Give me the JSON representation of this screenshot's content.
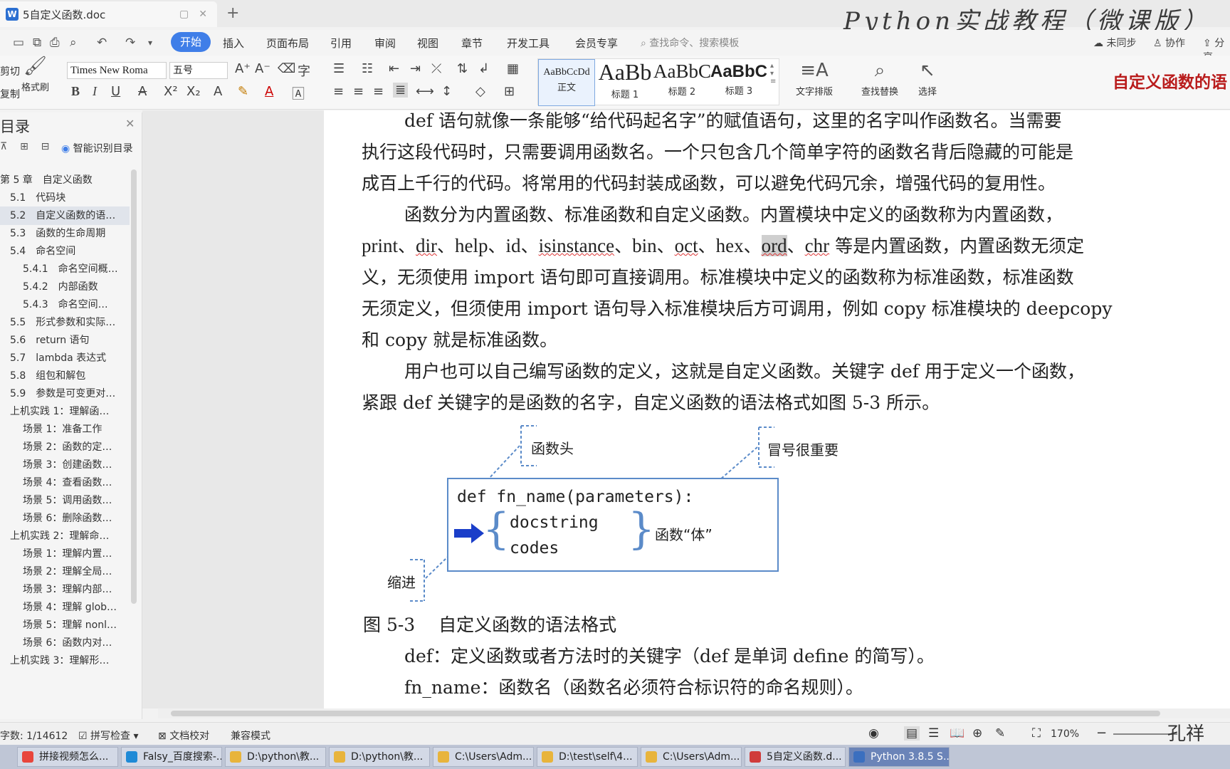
{
  "window": {
    "tab_title": "5自定义函数.doc",
    "new_tab": "+",
    "watermark": "Python实战教程（微课版）"
  },
  "menu": {
    "items": [
      "开始",
      "插入",
      "页面布局",
      "引用",
      "审阅",
      "视图",
      "章节",
      "开发工具",
      "会员专享"
    ],
    "search_placeholder": "查找命令、搜索模板",
    "sync": "未同步",
    "collab": "协作",
    "share": "分享"
  },
  "ribbon": {
    "cut": "剪切",
    "copy": "复制",
    "format_painter": "格式刷",
    "font_name": "Times New Roma",
    "font_size": "五号",
    "styles": [
      {
        "preview": "AaBbCcDd",
        "name": "正文"
      },
      {
        "preview": "AaBb",
        "name": "标题 1"
      },
      {
        "preview": "AaBbC",
        "name": "标题 2"
      },
      {
        "preview": "AaBbC",
        "name": "标题 3"
      }
    ],
    "text_layout": "文字排版",
    "find_replace": "查找替换",
    "select": "选择",
    "red_heading": "自定义函数的语"
  },
  "sidebar": {
    "title": "目录",
    "smart_toc": "智能识别目录",
    "items": [
      {
        "label": "第 5 章　自定义函数"
      },
      {
        "label": "5.1　代码块"
      },
      {
        "label": "5.2　自定义函数的语…"
      },
      {
        "label": "5.3　函数的生命周期"
      },
      {
        "label": "5.4　命名空间"
      },
      {
        "label": "5.4.1　命名空间概…"
      },
      {
        "label": "5.4.2　内部函数"
      },
      {
        "label": "5.4.3　命名空间…"
      },
      {
        "label": "5.5　形式参数和实际…"
      },
      {
        "label": "5.6　return 语句"
      },
      {
        "label": "5.7　lambda 表达式"
      },
      {
        "label": "5.8　组包和解包"
      },
      {
        "label": "5.9　参数是可变更对…"
      },
      {
        "label": "上机实践 1：理解函…"
      },
      {
        "label": "场景 1：准备工作"
      },
      {
        "label": "场景 2：函数的定…"
      },
      {
        "label": "场景 3：创建函数…"
      },
      {
        "label": "场景 4：查看函数…"
      },
      {
        "label": "场景 5：调用函数…"
      },
      {
        "label": "场景 6：删除函数…"
      },
      {
        "label": "上机实践 2：理解命…"
      },
      {
        "label": "场景 1：理解内置…"
      },
      {
        "label": "场景 2：理解全局…"
      },
      {
        "label": "场景 3：理解内部…"
      },
      {
        "label": "场景 4：理解 glob…"
      },
      {
        "label": "场景 5：理解 nonl…"
      },
      {
        "label": "场景 6：函数内对…"
      },
      {
        "label": "上机实践 3：理解形…"
      }
    ]
  },
  "document": {
    "p1": [
      "def 语句就像一条能够“给代码起名字”的赋值语句，这里的名字叫作函数名。当需要",
      "执行这段代码时，只需要调用函数名。一个只包含几个简单字符的函数名背后隐藏的可能是",
      "成百上千行的代码。将常用的代码封装成函数，可以避免代码冗余，增强代码的复用性。"
    ],
    "p2_l1": "函数分为内置函数、标准函数和自定义函数。内置模块中定义的函数称为内置函数，",
    "builtins": [
      "print",
      "dir",
      "help",
      "id",
      "isinstance",
      "bin",
      "oct",
      "hex",
      "ord",
      "chr"
    ],
    "p2_l2_tail": " 等是内置函数，内置函数无须定",
    "p2_l3": "义，无须使用 import 语句即可直接调用。标准模块中定义的函数称为标准函数，标准函数",
    "p2_l4": "无须定义，但须使用 import 语句导入标准模块后方可调用，例如 copy 标准模块的 deepcopy",
    "p2_l5": "和 copy 就是标准函数。",
    "p3": [
      "用户也可以自己编写函数的定义，这就是自定义函数。关键字 def 用于定义一个函数，",
      "紧跟 def 关键字的是函数的名字，自定义函数的语法格式如图 5-3 所示。"
    ],
    "figure": {
      "code_line1": "def fn_name(parameters):",
      "code_line2": "docstring",
      "code_line3": "codes",
      "label_head": "函数头",
      "label_colon": "冒号很重要",
      "label_body": "函数“体”",
      "label_indent": "缩进"
    },
    "caption": "图 5-3　 自定义函数的语法格式",
    "def_desc": [
      "def：定义函数或者方法时的关键字（def 是单词 define 的简写）。",
      "fn_name：函数名（函数名必须符合标识符的命名规则）。"
    ]
  },
  "statusbar": {
    "word_count": "字数: 1/14612",
    "spell_check": "拼写检查",
    "proofread": "文档校对",
    "compat": "兼容模式",
    "zoom": "170%",
    "signature": "孔祥"
  },
  "taskbar": {
    "items": [
      {
        "label": "拼接视频怎么...",
        "color": "#e8453c"
      },
      {
        "label": "Falsy_百度搜索-...",
        "color": "#1f8ad6"
      },
      {
        "label": "D:\\python\\教...",
        "color": "#e8b43c"
      },
      {
        "label": "D:\\python\\教...",
        "color": "#e8b43c"
      },
      {
        "label": "C:\\Users\\Adm...",
        "color": "#e8b43c"
      },
      {
        "label": "D:\\test\\self\\4...",
        "color": "#e8b43c"
      },
      {
        "label": "C:\\Users\\Adm...",
        "color": "#e8b43c"
      },
      {
        "label": "5自定义函数.d...",
        "color": "#d03b3b"
      },
      {
        "label": "Python 3.8.5 S...",
        "color": "#3b6fbf"
      }
    ]
  }
}
